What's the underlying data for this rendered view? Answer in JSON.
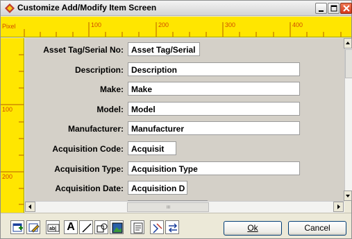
{
  "window": {
    "title": "Customize Add/Modify Item Screen"
  },
  "ruler": {
    "unit": "Pixel",
    "h_labels": [
      "100",
      "200",
      "300",
      "400"
    ],
    "v_labels": [
      "100",
      "200"
    ]
  },
  "form": {
    "fields": [
      {
        "label": "Asset Tag/Serial No:",
        "value": "Asset Tag/Serial"
      },
      {
        "label": "Description:",
        "value": "Description"
      },
      {
        "label": "Make:",
        "value": "Make"
      },
      {
        "label": "Model:",
        "value": "Model"
      },
      {
        "label": "Manufacturer:",
        "value": "Manufacturer"
      },
      {
        "label": "Acquisition Code:",
        "value": "Acquisit"
      },
      {
        "label": "Acquisition Type:",
        "value": "Acquisition Type"
      },
      {
        "label": "Acquisition Date:",
        "value": "Acquisition D"
      }
    ]
  },
  "scrollbar": {
    "h_grip": "III"
  },
  "toolbar": {
    "text_tool": "A",
    "ok_label": "Ok",
    "cancel_label": "Cancel"
  },
  "colors": {
    "ruler": "#ffe600",
    "ruler_text": "#d14b00",
    "form_bg": "#d4d0c8"
  },
  "icons": [
    "app-icon",
    "minimize-icon",
    "maximize-icon",
    "close-icon"
  ]
}
